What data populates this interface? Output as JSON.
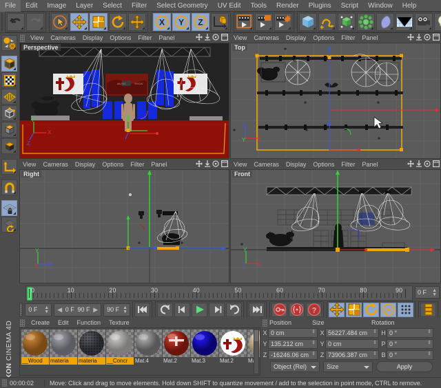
{
  "menu": {
    "items": [
      "File",
      "Edit",
      "Image",
      "Layer",
      "Select",
      "Filter",
      "Select Geometry",
      "UV Edit",
      "Tools",
      "Render",
      "Plugins",
      "Script",
      "Window",
      "Help"
    ]
  },
  "toolbar": {
    "groups": [
      {
        "name": "history",
        "buttons": [
          {
            "name": "undo-button",
            "icon": "undo",
            "active": false
          },
          {
            "name": "redo-button",
            "icon": "redo",
            "active": false
          }
        ]
      },
      {
        "name": "selection-transform",
        "buttons": [
          {
            "name": "live-selection-button",
            "icon": "cursor-circle",
            "active": false
          },
          {
            "name": "move-tool-button",
            "icon": "move",
            "active": true
          },
          {
            "name": "scale-tool-button",
            "icon": "scale",
            "active": true
          },
          {
            "name": "rotate-tool-button",
            "icon": "rotate",
            "active": false
          },
          {
            "name": "move-axis-button",
            "icon": "move-plain",
            "active": false
          }
        ]
      },
      {
        "name": "axis-locks",
        "buttons": [
          {
            "name": "lock-x-axis-button",
            "icon": "axis-x",
            "active": true
          },
          {
            "name": "lock-y-axis-button",
            "icon": "axis-y",
            "active": true
          },
          {
            "name": "lock-z-axis-button",
            "icon": "axis-z",
            "active": true
          },
          {
            "name": "world-object-coord-button",
            "icon": "world-coord",
            "active": false
          }
        ]
      },
      {
        "name": "render",
        "buttons": [
          {
            "name": "render-view-button",
            "icon": "render-view",
            "active": false
          },
          {
            "name": "render-region-button",
            "icon": "render-region",
            "active": false
          },
          {
            "name": "render-settings-button",
            "icon": "render-settings",
            "active": false
          }
        ]
      },
      {
        "name": "objects",
        "buttons": [
          {
            "name": "add-cube-button",
            "icon": "cube-blue",
            "active": false
          },
          {
            "name": "add-spline-button",
            "icon": "spline",
            "active": false
          },
          {
            "name": "nurbs-button",
            "icon": "nurbs",
            "active": false
          },
          {
            "name": "array-button",
            "icon": "array-green",
            "active": false
          },
          {
            "name": "deformer-button",
            "icon": "deformer",
            "active": false
          },
          {
            "name": "scene-button",
            "icon": "scene-env",
            "active": false
          },
          {
            "name": "camera-button",
            "icon": "camera",
            "active": false
          },
          {
            "name": "light-button",
            "icon": "light-bulb",
            "active": false
          }
        ]
      }
    ]
  },
  "leftbar": {
    "items": [
      {
        "name": "make-editable-button",
        "icon": "make-editable",
        "active": false
      },
      {
        "name": "model-mode-button",
        "icon": "cube-orange",
        "active": true
      },
      {
        "name": "texture-mode-button",
        "icon": "texture-checker",
        "active": false
      },
      {
        "name": "points-mode-button",
        "icon": "points-grid",
        "active": false
      },
      {
        "name": "edges-mode-button",
        "icon": "edges-cube",
        "active": false
      },
      {
        "name": "polygons-mode-button",
        "icon": "poly-cube",
        "active": false
      },
      {
        "name": "normal-mode-button",
        "icon": "normal-cube",
        "active": false
      },
      {
        "name": "axis-mode-button",
        "icon": "axis-L",
        "active": false
      },
      {
        "name": "snap-magnet-button",
        "icon": "magnet",
        "active": false
      },
      {
        "name": "lock-workplane-button",
        "icon": "plane-lock",
        "active": true
      },
      {
        "name": "workplane-rotate-button",
        "icon": "plane-rotate",
        "active": false
      }
    ]
  },
  "viewports": {
    "menu_items": [
      "View",
      "Cameras",
      "Display",
      "Options",
      "Filter",
      "Panel"
    ],
    "panes": [
      {
        "name": "viewport-perspective",
        "label": "Perspective"
      },
      {
        "name": "viewport-top",
        "label": "Top"
      },
      {
        "name": "viewport-right",
        "label": "Right"
      },
      {
        "name": "viewport-front",
        "label": "Front"
      }
    ]
  },
  "timeline": {
    "ticks": [
      0,
      10,
      20,
      30,
      40,
      50,
      60,
      70,
      80,
      90
    ],
    "min_frame": 0,
    "max_frame": 90,
    "current_frame_label": "0 F",
    "range_start_label": "0 F",
    "range_end_label": "90 F",
    "end_field_label": "90 F",
    "playhead_frame": 0
  },
  "transport": {
    "buttons": [
      {
        "name": "go-to-start-button",
        "icon": "skip-start",
        "active": false
      },
      {
        "name": "play-reverse-loop-button",
        "icon": "loop-rev",
        "active": false
      },
      {
        "name": "previous-frame-button",
        "icon": "step-back",
        "active": false
      },
      {
        "name": "play-button",
        "icon": "play",
        "active": false
      },
      {
        "name": "next-frame-button",
        "icon": "step-fwd",
        "active": false
      },
      {
        "name": "loop-button",
        "icon": "loop",
        "active": false
      },
      {
        "name": "go-to-end-button",
        "icon": "skip-end",
        "active": false
      }
    ],
    "key_buttons": [
      {
        "name": "record-keyframe-button",
        "icon": "key-record"
      },
      {
        "name": "autokeying-button",
        "icon": "key-auto"
      },
      {
        "name": "keyframe-selection-button",
        "icon": "key-question"
      }
    ],
    "key_toggles": [
      {
        "name": "key-position-button",
        "icon": "move",
        "active": true
      },
      {
        "name": "key-scale-button",
        "icon": "scale",
        "active": true
      },
      {
        "name": "key-rotation-button",
        "icon": "rotate",
        "active": true
      },
      {
        "name": "key-parameter-button",
        "icon": "param-p",
        "active": true
      },
      {
        "name": "key-pla-button",
        "icon": "pla-dots",
        "active": true
      }
    ],
    "extra_button": {
      "name": "timeline-layers-button",
      "icon": "layers"
    }
  },
  "materials": {
    "menu_items": [
      "Create",
      "Edit",
      "Function",
      "Texture"
    ],
    "items": [
      {
        "name": "material-wood",
        "label": "__Wood",
        "selected": true,
        "color1": "#d08a3a",
        "color2": "#7a4a15",
        "kind": "plain"
      },
      {
        "name": "material-materia-1",
        "label": "materia",
        "selected": true,
        "color1": "#a7a7ae",
        "color2": "#5c5c63",
        "kind": "plain"
      },
      {
        "name": "material-materia-2",
        "label": "materia",
        "selected": true,
        "color1": "#5c6066",
        "color2": "#2b2e33",
        "kind": "bumpy"
      },
      {
        "name": "material-concrete",
        "label": "__Concr",
        "selected": true,
        "color1": "#cfcdc8",
        "color2": "#7e7c78",
        "kind": "plain"
      },
      {
        "name": "material-mat-4",
        "label": "Mat.4",
        "selected": false,
        "color1": "#b5b5b5",
        "color2": "#585858",
        "kind": "plain"
      },
      {
        "name": "material-mat-2a",
        "label": "Mat.2",
        "selected": false,
        "color1": "#d9402f",
        "color2": "#6b140c",
        "kind": "logo-red"
      },
      {
        "name": "material-mat-3",
        "label": "Mat.3",
        "selected": false,
        "color1": "#2418ff",
        "color2": "#0a0470",
        "kind": "plain"
      },
      {
        "name": "material-mat-2b",
        "label": "Mat.2",
        "selected": false,
        "color1": "#ffffff",
        "color2": "#c9c9c9",
        "kind": "logo-white"
      },
      {
        "name": "material-mat",
        "label": "Mat",
        "selected": false,
        "color1": "#ecd5b4",
        "color2": "#9c8463",
        "kind": "plain"
      }
    ]
  },
  "coordinates": {
    "headers": [
      "Position",
      "Size",
      "Rotation"
    ],
    "rows": [
      {
        "axis_pos": "X",
        "pos": "0 cm",
        "axis_size": "X",
        "size": "56227.484 cm",
        "axis_rot": "H",
        "rot": "0 °"
      },
      {
        "axis_pos": "Y",
        "pos": "135.212 cm",
        "axis_size": "Y",
        "size": "0 cm",
        "axis_rot": "P",
        "rot": "0 °"
      },
      {
        "axis_pos": "Z",
        "pos": "-16246.06 cm",
        "axis_size": "Z",
        "size": "73906.387 cm",
        "axis_rot": "B",
        "rot": "0 °"
      }
    ],
    "mode_dropdown": "Object (Rel)",
    "size_dropdown": "Size",
    "apply_label": "Apply"
  },
  "brand": {
    "maxon": "MAXON",
    "product": "CINEMA 4D"
  },
  "status": {
    "time": "00:00:02",
    "message": "Move: Click and drag to move elements. Hold down SHIFT to quantize movement / add to the selection in point mode, CTRL to remove."
  },
  "colors": {
    "accent_orange": "#f0a500",
    "selection_blue": "#8fa8cc",
    "play_green": "#55e07a",
    "panel_bg": "#4c4c4c",
    "field_bg": "#5e5e5e",
    "viewport_bg": "#5b5b5b",
    "stage_red": "#8f1008"
  }
}
